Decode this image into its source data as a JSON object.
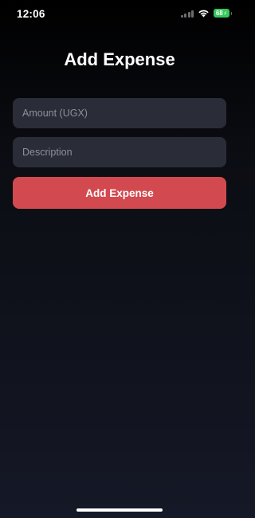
{
  "status_bar": {
    "time": "12:06",
    "battery_level": "68",
    "battery_charging": true,
    "icons": [
      "signal-icon",
      "wifi-icon",
      "battery-icon"
    ]
  },
  "page": {
    "title": "Add Expense"
  },
  "form": {
    "amount": {
      "placeholder": "Amount (UGX)",
      "value": ""
    },
    "description": {
      "placeholder": "Description",
      "value": ""
    },
    "submit_label": "Add Expense"
  },
  "colors": {
    "accent": "#d24a4f",
    "field_background": "#2a2d38",
    "battery": "#34c759"
  }
}
